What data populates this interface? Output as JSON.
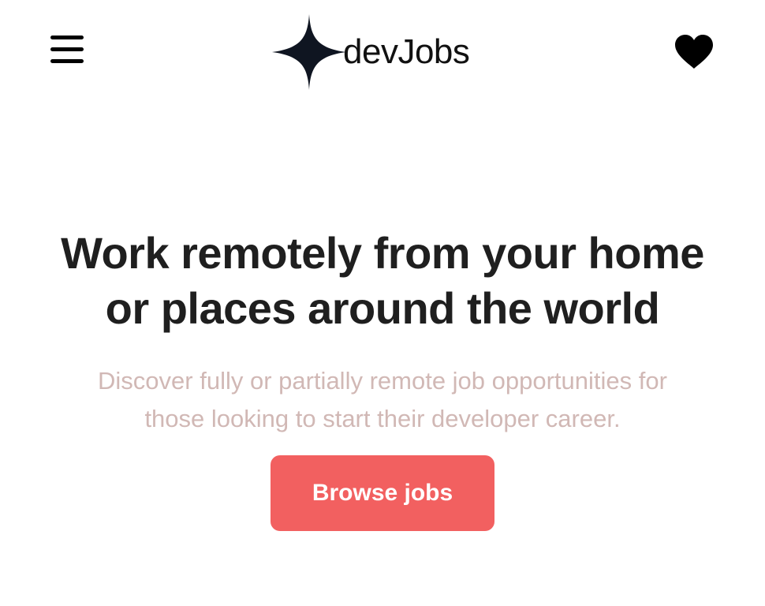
{
  "header": {
    "menu_icon": "hamburger-menu-icon",
    "logo": {
      "icon": "four-point-star-icon",
      "text": "devJobs"
    },
    "favorites_icon": "heart-icon"
  },
  "hero": {
    "title_line1": "Work remotely from your home",
    "title_line2": "or places around the world",
    "subtitle": "Discover fully or partially remote job opportunities for those looking to start their developer career.",
    "cta_label": "Browse jobs"
  },
  "colors": {
    "background": "#ffffff",
    "title": "#1f1f1f",
    "subtitle": "#d1b8b5",
    "cta_background": "#f26060",
    "cta_text": "#ffffff",
    "icons": "#000000"
  }
}
